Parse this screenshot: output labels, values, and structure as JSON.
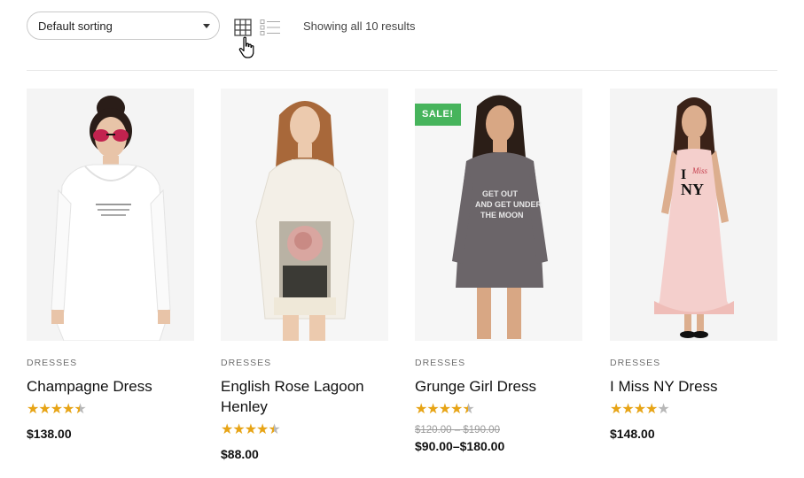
{
  "toolbar": {
    "sort_selected": "Default sorting",
    "result_count": "Showing all 10 results"
  },
  "products": [
    {
      "category": "DRESSES",
      "title": "Champagne Dress",
      "rating": 4.5,
      "price": "$138.00"
    },
    {
      "category": "DRESSES",
      "title": "English Rose Lagoon Henley",
      "rating": 4.5,
      "price": "$88.00"
    },
    {
      "category": "DRESSES",
      "title": "Grunge Girl Dress",
      "rating": 4.5,
      "sale_badge": "SALE!",
      "old_price_low": "$120.00",
      "old_price_sep": "–",
      "old_price_high": "$190.00",
      "price_low": "$90.00",
      "price_sep": "–",
      "price_high": "$180.00"
    },
    {
      "category": "DRESSES",
      "title": "I Miss NY Dress",
      "rating": 4,
      "price": "$148.00",
      "shirt_text_1": "I",
      "shirt_text_2": "Miss",
      "shirt_text_3": "NY"
    }
  ],
  "colors": {
    "accent_star": "#e7a416",
    "sale_badge": "#47b45c"
  }
}
